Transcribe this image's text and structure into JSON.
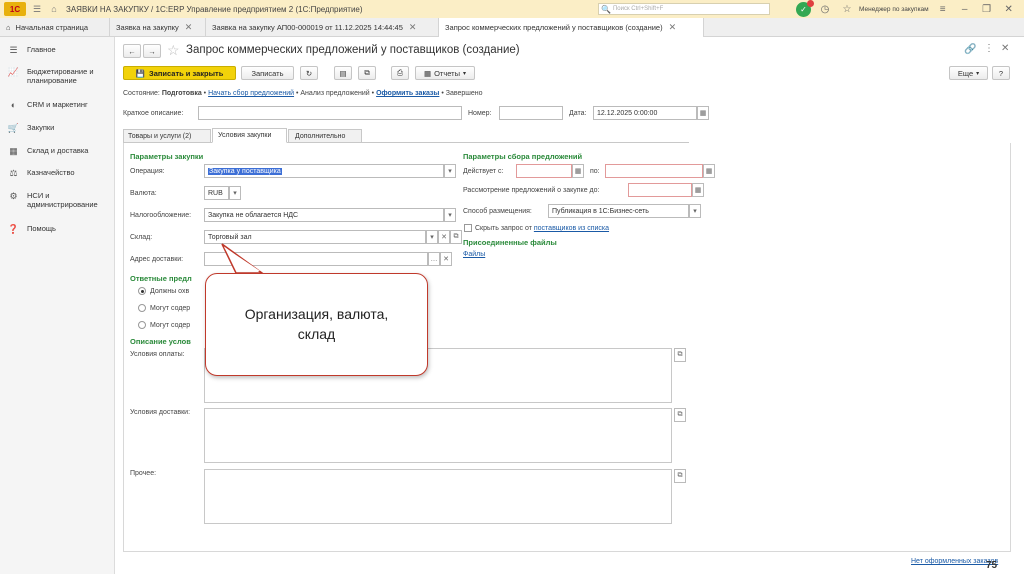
{
  "titlebar": {
    "logo": "1С",
    "title": "ЗАЯВКИ НА ЗАКУПКУ / 1С:ERP Управление предприятием 2  (1С:Предприятие)",
    "search_placeholder": "Поиск Ctrl+Shift+F",
    "badge": "✓",
    "user": "Менеджер по закупкам"
  },
  "tabs": [
    {
      "label": "Начальная страница"
    },
    {
      "label": "Заявка на закупку"
    },
    {
      "label": "Заявка на закупку АП00-000019 от 11.12.2025 14:44:45"
    },
    {
      "label": "Запрос коммерческих предложений у поставщиков (создание)"
    }
  ],
  "sidebar": {
    "items": [
      {
        "label": "Главное"
      },
      {
        "label": "Бюджетирование и планирование"
      },
      {
        "label": "CRM и маркетинг"
      },
      {
        "label": "Закупки"
      },
      {
        "label": "Склад и доставка"
      },
      {
        "label": "Казначейство"
      },
      {
        "label": "НСИ и администрирование"
      },
      {
        "label": "Помощь"
      }
    ]
  },
  "form": {
    "title": "Запрос коммерческих предложений у поставщиков (создание)",
    "toolbar": {
      "save_close": "Записать и закрыть",
      "save": "Записать",
      "reports": "Отчеты",
      "more": "Еще",
      "help": "?"
    },
    "state": {
      "label": "Состояние:",
      "current": "Подготовка",
      "step2": "Начать сбор предложений",
      "step3": "Анализ предложений",
      "step4": "Оформить заказы",
      "step5": "Завершено"
    },
    "short_desc_label": "Краткое описание:",
    "number_label": "Номер:",
    "date_label": "Дата:",
    "date_value": "12.12.2025  0:00:00",
    "subtabs": [
      "Товары и услуги (2)",
      "Условия закупки",
      "Дополнительно"
    ],
    "purchase_params": {
      "header": "Параметры закупки",
      "operation_label": "Операция:",
      "operation_value": "Закупка у поставщика",
      "currency_label": "Валюта:",
      "currency_value": "RUB",
      "tax_label": "Налогообложение:",
      "tax_value": "Закупка не облагается НДС",
      "warehouse_label": "Склад:",
      "warehouse_value": "Торговый зал",
      "address_label": "Адрес доставки:"
    },
    "responses": {
      "header": "Ответные предл",
      "opt1": "Должны охв",
      "opt2": "Могут содер",
      "opt3": "Могут содер"
    },
    "conditions": {
      "header": "Описание услов",
      "payment_label": "Условия оплаты:",
      "delivery_label": "Условия доставки:",
      "other_label": "Прочее:"
    },
    "collection": {
      "header": "Параметры сбора предложений",
      "valid_from_label": "Действует с:",
      "to_label": "по:",
      "review_label": "Рассмотрение предложений о закупке до:",
      "placement_label": "Способ размещения:",
      "placement_value": "Публикация в 1С:Бизнес-сеть",
      "hide_label": "Скрыть запрос от",
      "hide_link": "поставщиков из списка",
      "files_header": "Присоединенные файлы",
      "files_link": "Файлы"
    },
    "footer_link": "Нет оформленных заказов"
  },
  "callout": {
    "line1": "Организация, валюта,",
    "line2": "склад"
  },
  "slide_number": "75",
  "colors": {
    "titlebar_bg": "#fbeec6",
    "primary_button": "#f2d20a",
    "header_green": "#2a8a3a",
    "link_blue": "#1a5aa6",
    "callout_border": "#c0392b"
  }
}
